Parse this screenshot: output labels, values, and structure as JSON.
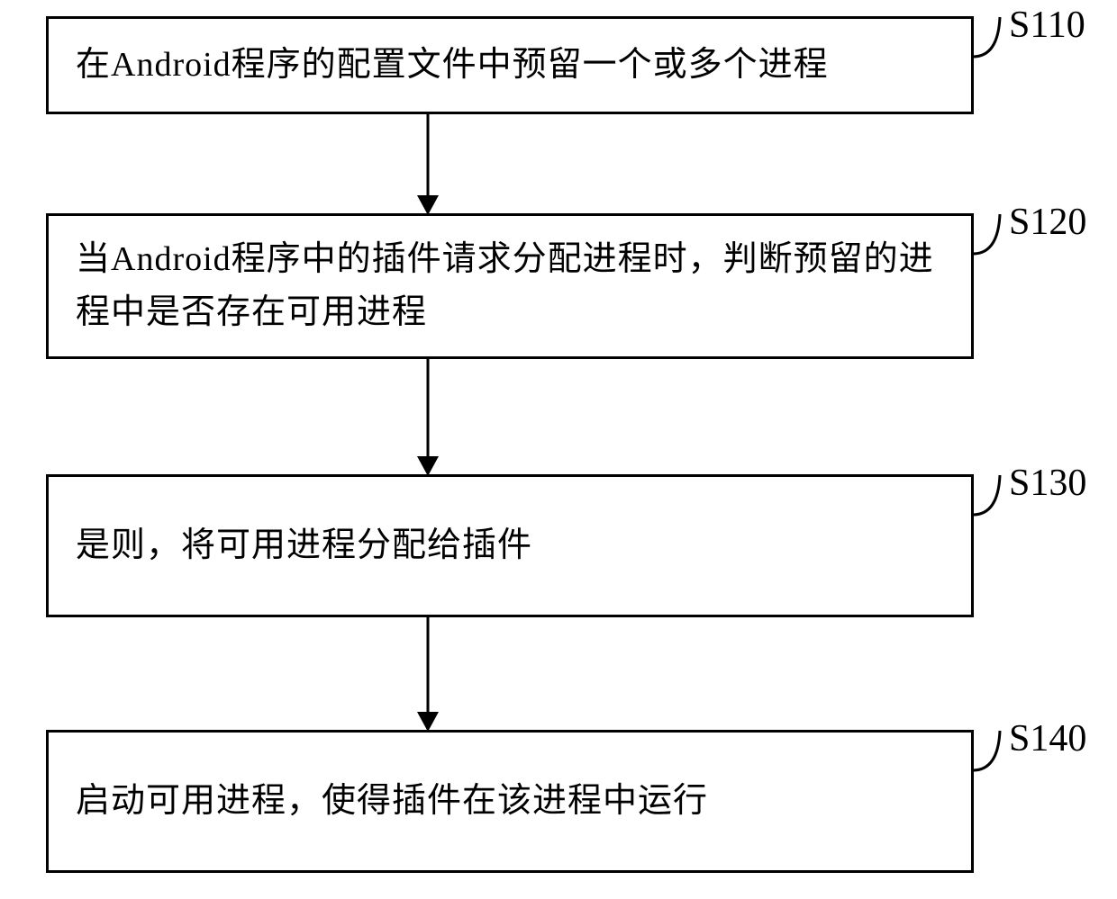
{
  "flowchart": {
    "steps": [
      {
        "id": "S110",
        "text": "在Android程序的配置文件中预留一个或多个进程"
      },
      {
        "id": "S120",
        "text": "当Android程序中的插件请求分配进程时，判断预留的进程中是否存在可用进程"
      },
      {
        "id": "S130",
        "text": "是则，将可用进程分配给插件"
      },
      {
        "id": "S140",
        "text": "启动可用进程，使得插件在该进程中运行"
      }
    ]
  }
}
